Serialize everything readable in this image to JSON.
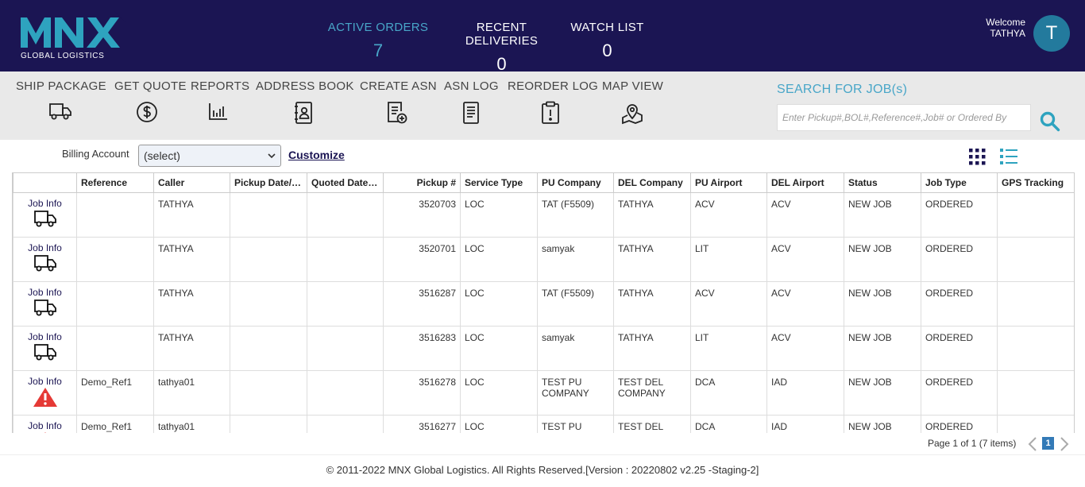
{
  "brand": {
    "logo_text": "MNX",
    "subtitle": "GLOBAL LOGISTICS",
    "accent": "#1b1553",
    "teal": "#2ea3bf"
  },
  "stats": [
    {
      "label": "ACTIVE ORDERS",
      "value": "7",
      "active": true
    },
    {
      "label": "RECENT DELIVERIES",
      "value": "0",
      "active": false
    },
    {
      "label": "WATCH LIST",
      "value": "0",
      "active": false
    }
  ],
  "user": {
    "welcome": "Welcome",
    "name": "TATHYA",
    "initial": "T"
  },
  "menu": [
    {
      "label": "SHIP PACKAGE",
      "icon": "truck-icon"
    },
    {
      "label": "GET QUOTE",
      "icon": "dollar-icon"
    },
    {
      "label": "REPORTS",
      "icon": "bar-chart-icon"
    },
    {
      "label": "ADDRESS BOOK",
      "icon": "address-book-icon"
    },
    {
      "label": "CREATE ASN",
      "icon": "document-add-icon"
    },
    {
      "label": "ASN LOG",
      "icon": "document-icon"
    },
    {
      "label": "REORDER LOG",
      "icon": "clipboard-alert-icon"
    },
    {
      "label": "MAP VIEW",
      "icon": "map-pin-icon"
    }
  ],
  "search": {
    "label": "SEARCH FOR JOB(s)",
    "placeholder": "Enter Pickup#,BOL#,Reference#,Job# or Ordered By"
  },
  "billing": {
    "label": "Billing Account",
    "selected": "(select)",
    "customize": "Customize"
  },
  "table": {
    "headers": [
      "",
      "Reference",
      "Caller",
      "Pickup Date/Time",
      "Quoted Date/Time",
      "Pickup #",
      "Service Type",
      "PU Company",
      "DEL Company",
      "PU Airport",
      "DEL Airport",
      "Status",
      "Job Type",
      "GPS Tracking"
    ],
    "job_info_label": "Job Info",
    "rows": [
      {
        "icon": "truck",
        "reference": "",
        "caller": "TATHYA",
        "pickup_dt": "",
        "quoted_dt": "",
        "pickup_no": "3520703",
        "service": "LOC",
        "pu_company": "TAT (F5509)",
        "del_company": "TATHYA",
        "pu_airport": "ACV",
        "del_airport": "ACV",
        "status": "NEW JOB",
        "job_type": "ORDERED",
        "gps": ""
      },
      {
        "icon": "truck",
        "reference": "",
        "caller": "TATHYA",
        "pickup_dt": "",
        "quoted_dt": "",
        "pickup_no": "3520701",
        "service": "LOC",
        "pu_company": "samyak",
        "del_company": "TATHYA",
        "pu_airport": "LIT",
        "del_airport": "ACV",
        "status": "NEW JOB",
        "job_type": "ORDERED",
        "gps": ""
      },
      {
        "icon": "truck",
        "reference": "",
        "caller": "TATHYA",
        "pickup_dt": "",
        "quoted_dt": "",
        "pickup_no": "3516287",
        "service": "LOC",
        "pu_company": "TAT (F5509)",
        "del_company": "TATHYA",
        "pu_airport": "ACV",
        "del_airport": "ACV",
        "status": "NEW JOB",
        "job_type": "ORDERED",
        "gps": ""
      },
      {
        "icon": "truck",
        "reference": "",
        "caller": "TATHYA",
        "pickup_dt": "",
        "quoted_dt": "",
        "pickup_no": "3516283",
        "service": "LOC",
        "pu_company": "samyak",
        "del_company": "TATHYA",
        "pu_airport": "LIT",
        "del_airport": "ACV",
        "status": "NEW JOB",
        "job_type": "ORDERED",
        "gps": ""
      },
      {
        "icon": "warning",
        "reference": "Demo_Ref1",
        "caller": "tathya01",
        "pickup_dt": "",
        "quoted_dt": "",
        "pickup_no": "3516278",
        "service": "LOC",
        "pu_company": "TEST PU COMPANY",
        "del_company": "TEST DEL COMPANY",
        "pu_airport": "DCA",
        "del_airport": "IAD",
        "status": "NEW JOB",
        "job_type": "ORDERED",
        "gps": ""
      },
      {
        "icon": "warning",
        "reference": "Demo_Ref1",
        "caller": "tathya01",
        "pickup_dt": "",
        "quoted_dt": "",
        "pickup_no": "3516277",
        "service": "LOC",
        "pu_company": "TEST PU COMPANY",
        "del_company": "TEST DEL COMPANY",
        "pu_airport": "DCA",
        "del_airport": "IAD",
        "status": "NEW JOB",
        "job_type": "ORDERED",
        "gps": ""
      }
    ]
  },
  "pager": {
    "summary": "Page 1 of 1 (7 items)",
    "current": "1"
  },
  "footer": {
    "text": "© 2011-2022 MNX Global Logistics. All Rights Reserved.[Version : 20220802 v2.25 -Staging-2]"
  }
}
